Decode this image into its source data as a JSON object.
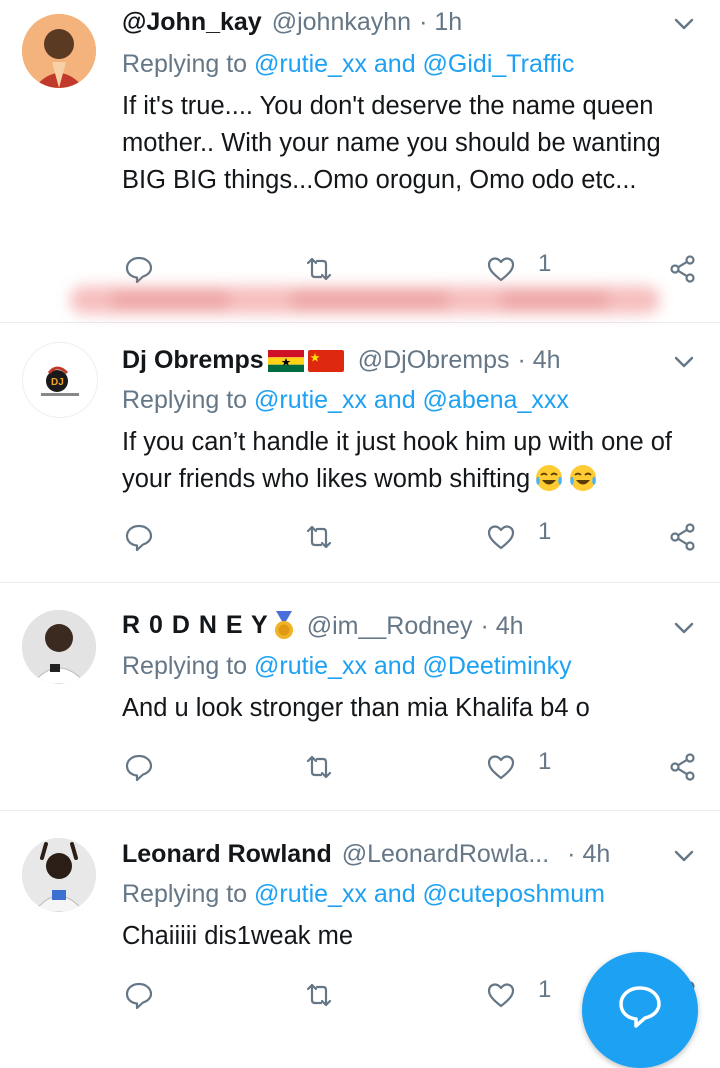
{
  "tweets": [
    {
      "name": "@John_kay",
      "handle": "@johnkayhn",
      "time": "· 1h",
      "replying_prefix": "Replying to ",
      "reply_users": "@rutie_xx and @Gidi_Traffic",
      "text": "If it's true.... You don't deserve the name queen mother.. With your name you should be wanting BIG BIG things...Omo orogun, Omo odo etc...",
      "likes": "1"
    },
    {
      "name": "Dj Obremps",
      "handle": "@DjObremps",
      "time": "· 4h",
      "replying_prefix": "Replying to ",
      "reply_users": "@rutie_xx and @abena_xxx",
      "text": "If you can’t handle it just hook him up with one of your friends who likes womb shifting",
      "likes": "1"
    },
    {
      "name": "R 0 D N E Y",
      "handle": "@im__Rodney",
      "time": "· 4h",
      "replying_prefix": "Replying to ",
      "reply_users": "@rutie_xx and @Deetiminky",
      "text": "And u look stronger than mia Khalifa b4 o",
      "likes": "1"
    },
    {
      "name": "Leonard Rowland",
      "handle": "@LeonardRowla...",
      "time": "· 4h",
      "replying_prefix": "Replying to ",
      "reply_users": "@rutie_xx and @cuteposhmum",
      "text": "Chaiiiii dis1weak me",
      "likes": "1"
    }
  ],
  "colors": {
    "accent": "#1da1f2",
    "muted": "#657786",
    "text": "#14171a",
    "divider": "#e6ecf0"
  },
  "icons": [
    "reply-icon",
    "retweet-icon",
    "like-icon",
    "share-icon",
    "chevron-down-icon",
    "compose-icon"
  ]
}
